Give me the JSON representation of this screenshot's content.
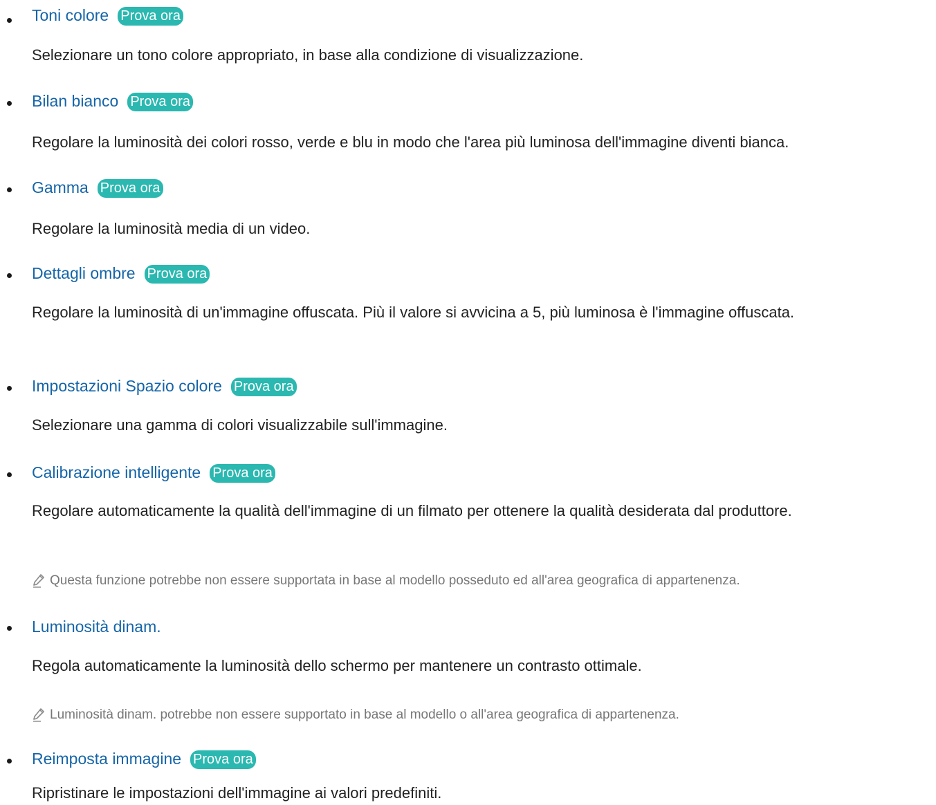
{
  "try_label": "Prova ora",
  "items": [
    {
      "title": "Toni colore",
      "desc": "Selezionare un tono colore appropriato, in base alla condizione di visualizzazione."
    },
    {
      "title": "Bilan bianco",
      "desc": "Regolare la luminosità dei colori rosso, verde e blu in modo che l'area più luminosa dell'immagine diventi bianca."
    },
    {
      "title": "Gamma",
      "desc": "Regolare la luminosità media di un video."
    },
    {
      "title": "Dettagli ombre",
      "desc": "Regolare la luminosità di un'immagine offuscata. Più il valore si avvicina a 5, più luminosa è l'immagine offuscata."
    },
    {
      "title": "Impostazioni Spazio colore",
      "desc": "Selezionare una gamma di colori visualizzabile sull'immagine."
    },
    {
      "title": "Calibrazione intelligente",
      "desc": "Regolare automaticamente la qualità dell'immagine di un filmato per ottenere la qualità desiderata dal produttore.",
      "note": "Questa funzione potrebbe non essere supportata in base al modello posseduto ed all'area geografica di appartenenza."
    },
    {
      "title": "Luminosità dinam.",
      "desc": "Regola automaticamente la luminosità dello schermo per mantenere un contrasto ottimale.",
      "note": "Luminosità dinam. potrebbe non essere supportato in base al modello o all'area geografica di appartenenza."
    },
    {
      "title": "Reimposta immagine",
      "desc": "Ripristinare le impostazioni dell'immagine ai valori predefiniti."
    }
  ],
  "colors": {
    "title": "#1565a8",
    "badge": "#2ab8b0",
    "note": "#777777"
  },
  "icons": {
    "note": "pencil-icon"
  }
}
